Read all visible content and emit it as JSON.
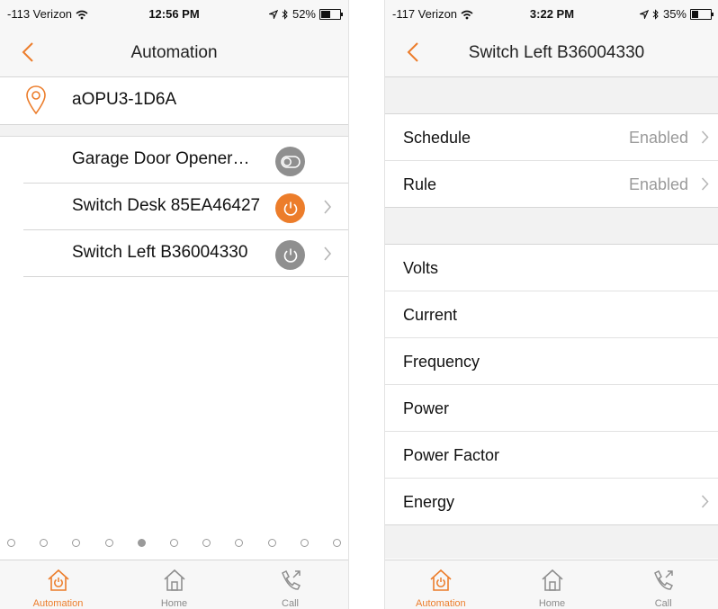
{
  "left": {
    "status": {
      "carrier": "-113 Verizon",
      "time": "12:56 PM",
      "battery": "52%",
      "battery_level": 0.52
    },
    "title": "Automation",
    "location": "aOPU3-1D6A",
    "devices": [
      {
        "name": "Garage Door Opener…",
        "state": "toggle",
        "color": "#8f8f8f"
      },
      {
        "name": "Switch Desk 85EA46427",
        "state": "power-on",
        "color": "#ec7d2b"
      },
      {
        "name": "Switch Left B36004330",
        "state": "power-off",
        "color": "#8f8f8f"
      }
    ],
    "page_dots": {
      "count": 11,
      "active": 4
    },
    "tabs": [
      {
        "label": "Automation",
        "icon": "house-power-icon",
        "active": true
      },
      {
        "label": "Home",
        "icon": "house-icon",
        "active": false
      },
      {
        "label": "Call",
        "icon": "phone-call-icon",
        "active": false
      }
    ]
  },
  "right": {
    "status": {
      "carrier": "-117 Verizon",
      "time": "3:22 PM",
      "battery": "35%",
      "battery_level": 0.35
    },
    "title": "Switch Left B36004330",
    "group1": [
      {
        "label": "Schedule",
        "value": "Enabled",
        "chevron": true
      },
      {
        "label": "Rule",
        "value": "Enabled",
        "chevron": true
      }
    ],
    "group2": [
      {
        "label": "Volts",
        "value": "",
        "chevron": false
      },
      {
        "label": "Current",
        "value": "",
        "chevron": false
      },
      {
        "label": "Frequency",
        "value": "",
        "chevron": false
      },
      {
        "label": "Power",
        "value": "",
        "chevron": false
      },
      {
        "label": "Power Factor",
        "value": "",
        "chevron": false
      },
      {
        "label": "Energy",
        "value": "",
        "chevron": true
      }
    ],
    "tabs": [
      {
        "label": "Automation",
        "icon": "house-power-icon",
        "active": true
      },
      {
        "label": "Home",
        "icon": "house-icon",
        "active": false
      },
      {
        "label": "Call",
        "icon": "phone-call-icon",
        "active": false
      }
    ]
  },
  "colors": {
    "accent": "#ec7d2b",
    "inactive": "#8f8f8f"
  }
}
